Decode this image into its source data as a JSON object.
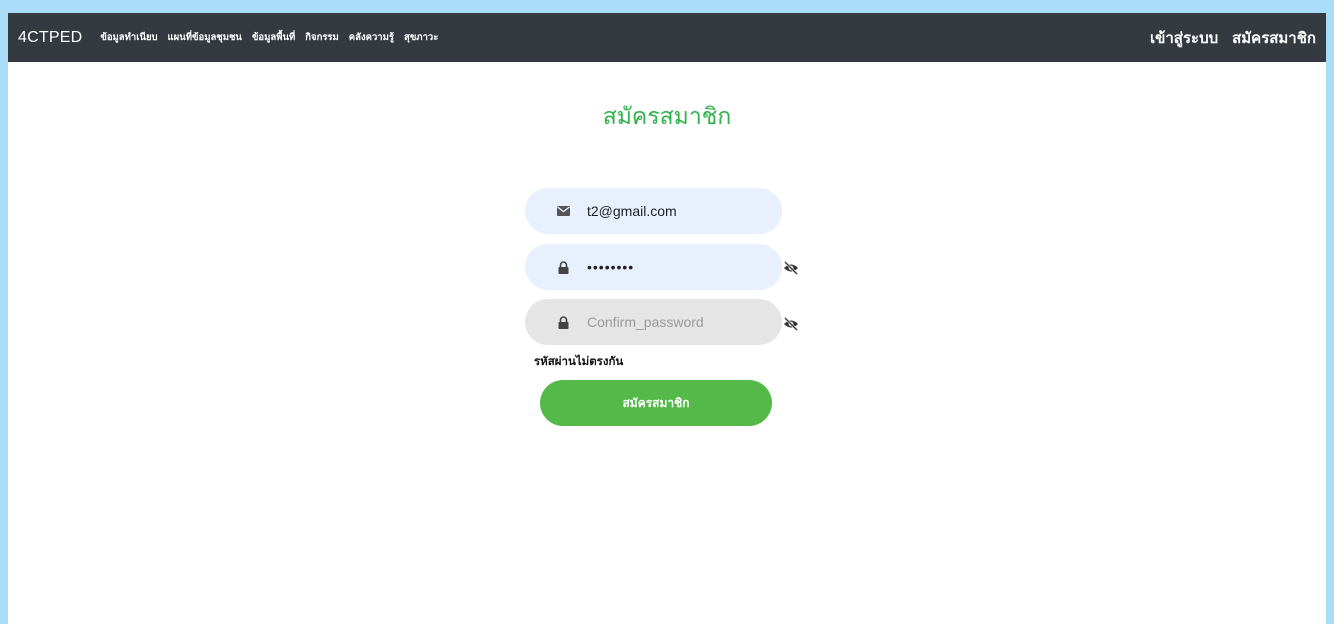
{
  "navbar": {
    "brand": "4CTPED",
    "links": [
      "ข้อมูลทำเนียบ",
      "แผนที่ข้อมูลชุมชน",
      "ข้อมูลพื้นที่",
      "กิจกรรม",
      "คลังความรู้",
      "สุขภาวะ"
    ],
    "right_links": [
      "เข้าสู่ระบบ",
      "สมัครสมาชิก"
    ]
  },
  "form": {
    "title": "สมัครสมาชิก",
    "email_value": "t2@gmail.com",
    "email_icon": "envelope-icon",
    "password_value": "••••••••",
    "password_icon": "lock-icon",
    "confirm_placeholder": "Confirm_password",
    "confirm_icon": "lock-icon",
    "eye_icon": "eye-slash-icon",
    "error_message": "รหัสผ่านไม่ตรงกัน",
    "submit_label": "สมัครสมาชิก"
  },
  "colors": {
    "navbar_bg": "#343a40",
    "title_green": "#2fb24b",
    "button_green": "#55b94a",
    "autofill_bg": "#e8f0fe",
    "outer_bg": "#a9dcf6"
  }
}
